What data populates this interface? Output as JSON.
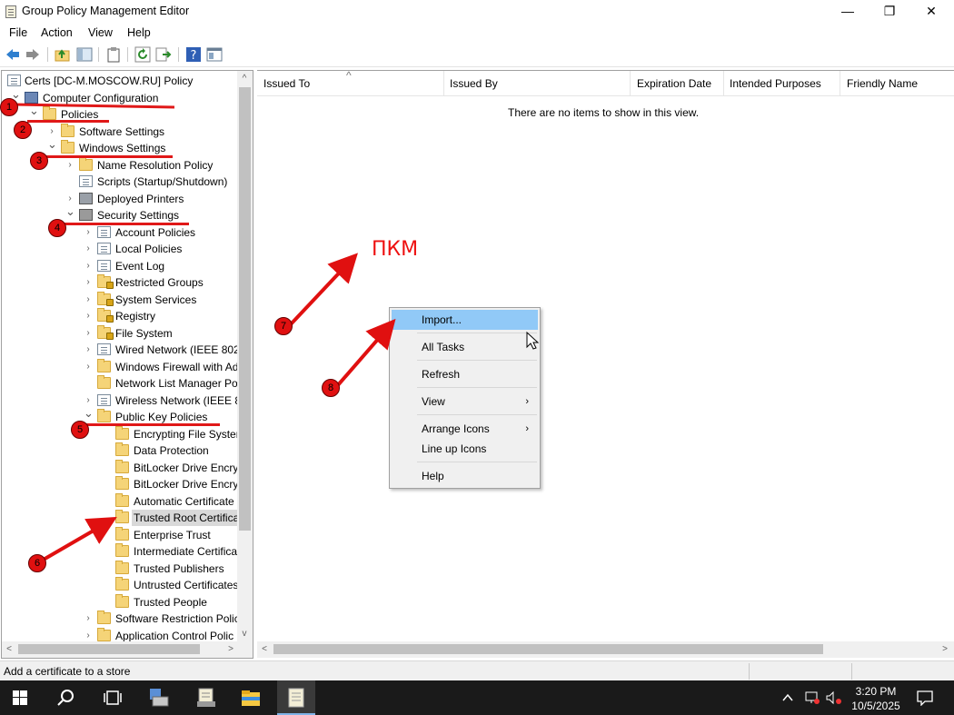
{
  "window": {
    "title": "Group Policy Management Editor",
    "minimize": "—",
    "restore": "❐",
    "close": "✕"
  },
  "menubar": {
    "items": [
      "File",
      "Action",
      "View",
      "Help"
    ]
  },
  "tree": {
    "items": [
      {
        "label": "Certs [DC-M.MOSCOW.RU] Policy",
        "icon": "policy",
        "chevron": "",
        "depth": 0
      },
      {
        "label": "Computer Configuration",
        "icon": "computer",
        "chevron": "⌄",
        "depth": 1
      },
      {
        "label": "Policies",
        "icon": "folder",
        "chevron": "⌄",
        "depth": 2
      },
      {
        "label": "Software Settings",
        "icon": "folder",
        "chevron": "›",
        "depth": 3
      },
      {
        "label": "Windows Settings",
        "icon": "folder",
        "chevron": "⌄",
        "depth": 3
      },
      {
        "label": "Name Resolution Policy",
        "icon": "folder",
        "chevron": "›",
        "depth": 4
      },
      {
        "label": "Scripts (Startup/Shutdown)",
        "icon": "doc",
        "chevron": "",
        "depth": 4
      },
      {
        "label": "Deployed Printers",
        "icon": "printer",
        "chevron": "›",
        "depth": 4
      },
      {
        "label": "Security Settings",
        "icon": "shield",
        "chevron": "⌄",
        "depth": 4
      },
      {
        "label": "Account Policies",
        "icon": "doc",
        "chevron": "›",
        "depth": 5
      },
      {
        "label": "Local Policies",
        "icon": "doc",
        "chevron": "›",
        "depth": 5
      },
      {
        "label": "Event Log",
        "icon": "doc",
        "chevron": "›",
        "depth": 5
      },
      {
        "label": "Restricted Groups",
        "icon": "lockfolder",
        "chevron": "›",
        "depth": 5
      },
      {
        "label": "System Services",
        "icon": "lockfolder",
        "chevron": "›",
        "depth": 5
      },
      {
        "label": "Registry",
        "icon": "lockfolder",
        "chevron": "›",
        "depth": 5
      },
      {
        "label": "File System",
        "icon": "lockfolder",
        "chevron": "›",
        "depth": 5
      },
      {
        "label": "Wired Network (IEEE 802.",
        "icon": "doc",
        "chevron": "›",
        "depth": 5
      },
      {
        "label": "Windows Firewall with Ad",
        "icon": "folder",
        "chevron": "›",
        "depth": 5
      },
      {
        "label": "Network List Manager Po",
        "icon": "folder",
        "chevron": "",
        "depth": 5
      },
      {
        "label": "Wireless Network (IEEE 80",
        "icon": "doc",
        "chevron": "›",
        "depth": 5
      },
      {
        "label": "Public Key Policies",
        "icon": "folder",
        "chevron": "⌄",
        "depth": 5
      },
      {
        "label": "Encrypting File Systen",
        "icon": "folder",
        "chevron": "",
        "depth": 6
      },
      {
        "label": "Data Protection",
        "icon": "folder",
        "chevron": "",
        "depth": 6
      },
      {
        "label": "BitLocker Drive Encry",
        "icon": "folder",
        "chevron": "",
        "depth": 6
      },
      {
        "label": "BitLocker Drive Encry",
        "icon": "folder",
        "chevron": "",
        "depth": 6
      },
      {
        "label": "Automatic Certificate",
        "icon": "folder",
        "chevron": "",
        "depth": 6
      },
      {
        "label": "Trusted Root Certifica",
        "icon": "folder",
        "chevron": "",
        "depth": 6,
        "selected": true
      },
      {
        "label": "Enterprise Trust",
        "icon": "folder",
        "chevron": "",
        "depth": 6
      },
      {
        "label": "Intermediate Certifica",
        "icon": "folder",
        "chevron": "",
        "depth": 6
      },
      {
        "label": "Trusted Publishers",
        "icon": "folder",
        "chevron": "",
        "depth": 6
      },
      {
        "label": "Untrusted Certificates",
        "icon": "folder",
        "chevron": "",
        "depth": 6
      },
      {
        "label": "Trusted People",
        "icon": "folder",
        "chevron": "",
        "depth": 6
      },
      {
        "label": "Software Restriction Polic",
        "icon": "folder",
        "chevron": "›",
        "depth": 5
      },
      {
        "label": "Application Control Polic",
        "icon": "folder",
        "chevron": "›",
        "depth": 5
      }
    ]
  },
  "list": {
    "columns": [
      "Issued To",
      "Issued By",
      "Expiration Date",
      "Intended Purposes",
      "Friendly Name"
    ],
    "sort_indicator": "^",
    "empty_message": "There are no items to show in this view."
  },
  "context_menu": {
    "items": [
      {
        "label": "Import...",
        "submenu": false,
        "highlighted": true
      },
      {
        "label": "All Tasks",
        "submenu": false
      },
      {
        "label": "Refresh",
        "submenu": false
      },
      {
        "label": "View",
        "submenu": true
      },
      {
        "label": "Arrange Icons",
        "submenu": true
      },
      {
        "label": "Line up Icons",
        "submenu": false
      },
      {
        "label": "Help",
        "submenu": false
      }
    ],
    "submenu_arrow": "›"
  },
  "statusbar": {
    "text": "Add a certificate to a store"
  },
  "annotations": {
    "markers": [
      "1",
      "2",
      "3",
      "4",
      "5",
      "6",
      "7",
      "8"
    ],
    "label_pkm": "ПКМ",
    "color": "#e01010"
  },
  "taskbar": {
    "time": "3:20 PM",
    "date": "10/5/2025"
  },
  "scroll": {
    "up": "^",
    "down": "v",
    "left": "<",
    "right": ">"
  }
}
